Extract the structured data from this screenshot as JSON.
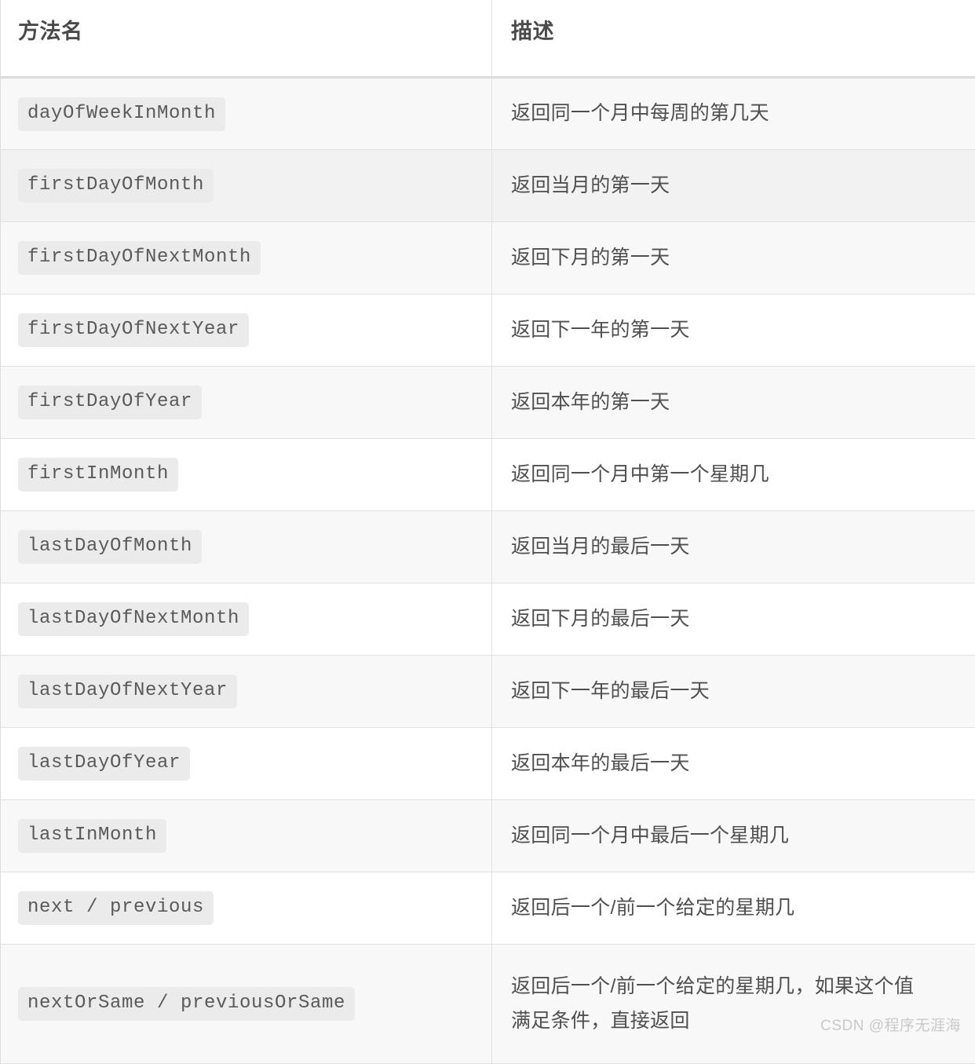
{
  "table": {
    "headers": {
      "method": "方法名",
      "description": "描述"
    },
    "rows": [
      {
        "method": "dayOfWeekInMonth",
        "description": "返回同一个月中每周的第几天"
      },
      {
        "method": "firstDayOfMonth",
        "description": "返回当月的第一天"
      },
      {
        "method": "firstDayOfNextMonth",
        "description": "返回下月的第一天"
      },
      {
        "method": "firstDayOfNextYear",
        "description": "返回下一年的第一天"
      },
      {
        "method": "firstDayOfYear",
        "description": "返回本年的第一天"
      },
      {
        "method": "firstInMonth",
        "description": "返回同一个月中第一个星期几"
      },
      {
        "method": "lastDayOfMonth",
        "description": "返回当月的最后一天"
      },
      {
        "method": "lastDayOfNextMonth",
        "description": "返回下月的最后一天"
      },
      {
        "method": "lastDayOfNextYear",
        "description": "返回下一年的最后一天"
      },
      {
        "method": "lastDayOfYear",
        "description": "返回本年的最后一天"
      },
      {
        "method": "lastInMonth",
        "description": "返回同一个月中最后一个星期几"
      },
      {
        "method": "next / previous",
        "description": "返回后一个/前一个给定的星期几"
      },
      {
        "method": "nextOrSame / previousOrSame",
        "description": "返回后一个/前一个给定的星期几，如果这个值",
        "description_line2": "满足条件，直接返回"
      }
    ]
  },
  "watermark": "CSDN @程序无涯海",
  "colors": {
    "row_light": "#f8f8f8",
    "row_dark": "#f2f2f2",
    "row_white": "#ffffff",
    "badge_bg": "#ebebeb",
    "badge_text": "#5a5a5a",
    "header_text": "#4a4a4a",
    "body_text": "#4f4f4f",
    "border": "#e0e0e0",
    "watermark_text": "#c9c9c9"
  }
}
